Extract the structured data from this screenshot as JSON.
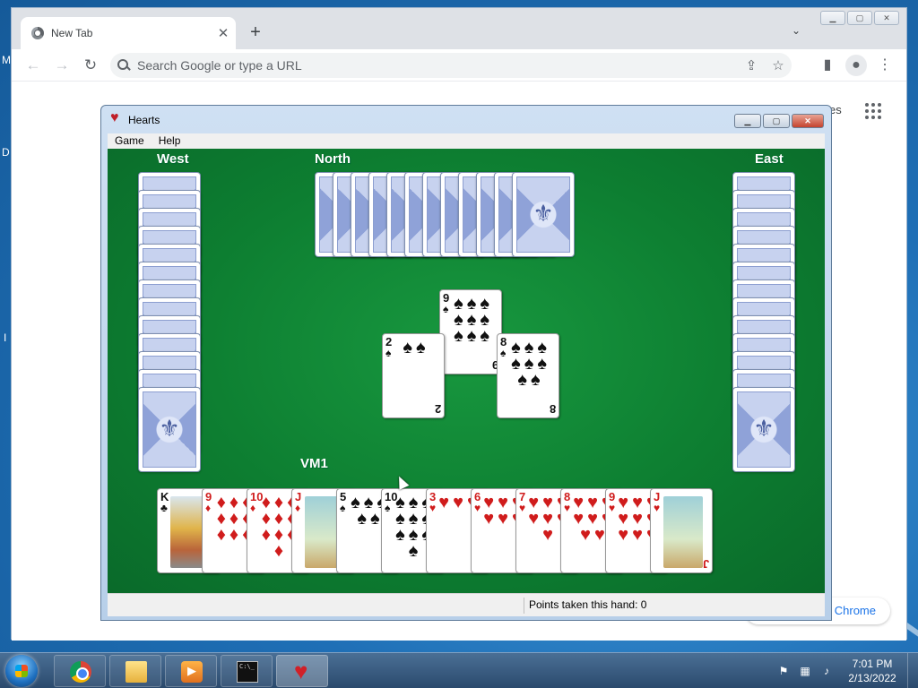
{
  "desktop": {
    "edge_letters": [
      "M",
      "D",
      "I"
    ]
  },
  "chrome": {
    "tab_title": "New Tab",
    "tab_close": "✕",
    "new_tab": "+",
    "tab_search": "⌄",
    "omnibox_placeholder": "Search Google or type a URL",
    "back": "←",
    "forward": "→",
    "reload": "↻",
    "share": "⇪",
    "bookmark": "☆",
    "side_panel": "▮",
    "menu": "⋮",
    "page_text_fragment": "es",
    "customize_label": "Chrome"
  },
  "hearts": {
    "title": "Hearts",
    "menu": [
      "Game",
      "Help"
    ],
    "players": {
      "west": "West",
      "north": "North",
      "east": "East",
      "south": "VM1"
    },
    "status": "Points taken this hand: 0",
    "trick": [
      {
        "rank": "9",
        "suit": "♠",
        "color": "black"
      },
      {
        "rank": "2",
        "suit": "♠",
        "color": "black"
      },
      {
        "rank": "8",
        "suit": "♠",
        "color": "black"
      }
    ],
    "hand": [
      {
        "rank": "K",
        "suit": "♣",
        "color": "black"
      },
      {
        "rank": "9",
        "suit": "♦",
        "color": "red"
      },
      {
        "rank": "10",
        "suit": "♦",
        "color": "red"
      },
      {
        "rank": "J",
        "suit": "♦",
        "color": "red"
      },
      {
        "rank": "5",
        "suit": "♠",
        "color": "black"
      },
      {
        "rank": "10",
        "suit": "♠",
        "color": "black"
      },
      {
        "rank": "3",
        "suit": "♥",
        "color": "red"
      },
      {
        "rank": "6",
        "suit": "♥",
        "color": "red"
      },
      {
        "rank": "7",
        "suit": "♥",
        "color": "red"
      },
      {
        "rank": "8",
        "suit": "♥",
        "color": "red"
      },
      {
        "rank": "9",
        "suit": "♥",
        "color": "red"
      },
      {
        "rank": "J",
        "suit": "♥",
        "color": "red"
      }
    ],
    "west_card_count": 13,
    "north_card_count": 12,
    "east_card_count": 13
  },
  "taskbar": {
    "time": "7:01 PM",
    "date": "2/13/2022",
    "apps": [
      "chrome",
      "explorer",
      "media-player",
      "cmd",
      "hearts"
    ]
  },
  "colors": {
    "felt": "#0d7e31",
    "red_suit": "#d01c1c",
    "accent": "#1a73e8"
  }
}
